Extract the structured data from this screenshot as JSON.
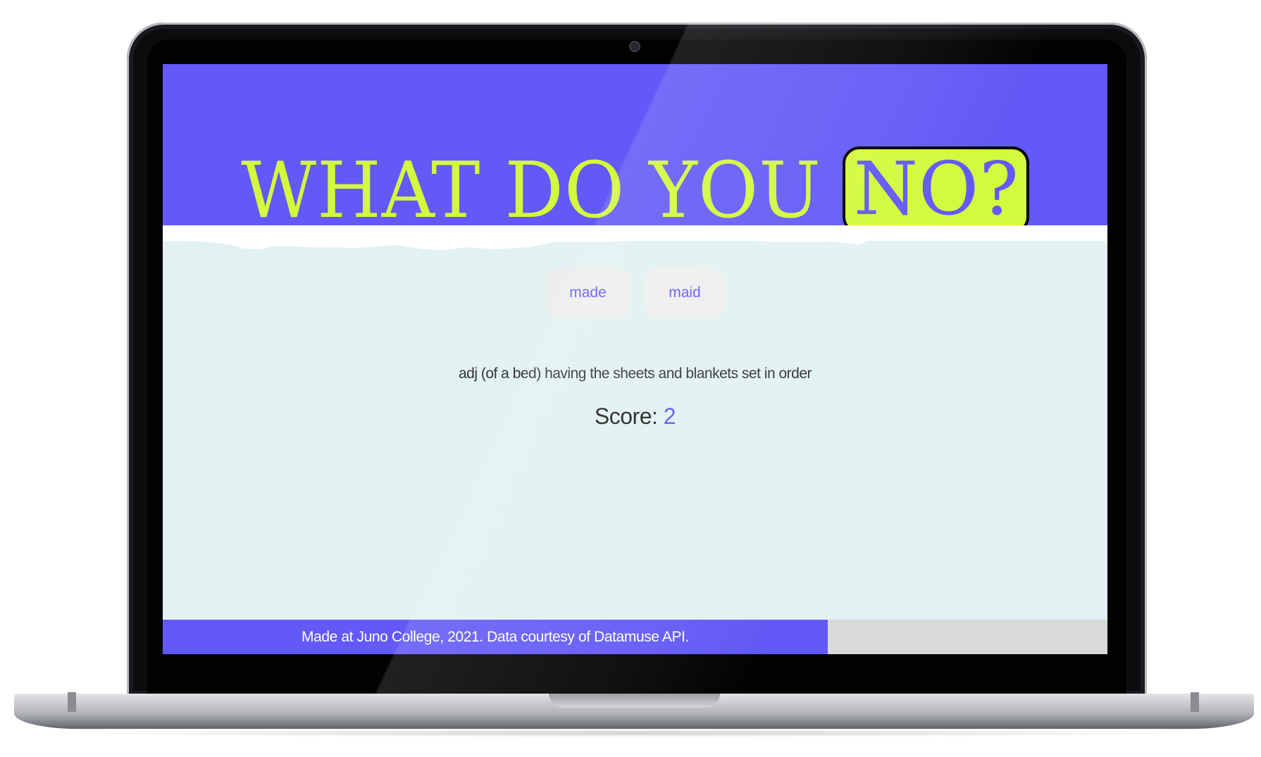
{
  "header": {
    "title_main": "WHAT DO YOU",
    "title_highlight": "NO?"
  },
  "game": {
    "options": [
      {
        "label": "made"
      },
      {
        "label": "maid"
      }
    ],
    "definition": "adj (of a bed) having the sheets and blankets set in order",
    "score_label": "Score:",
    "score_value": "2"
  },
  "footer": {
    "text": "Made at Juno College, 2021. Data courtesy of Datamuse API."
  },
  "colors": {
    "primary": "#6259f6",
    "accent": "#d3fa3c",
    "background": "#e2f1f1"
  }
}
